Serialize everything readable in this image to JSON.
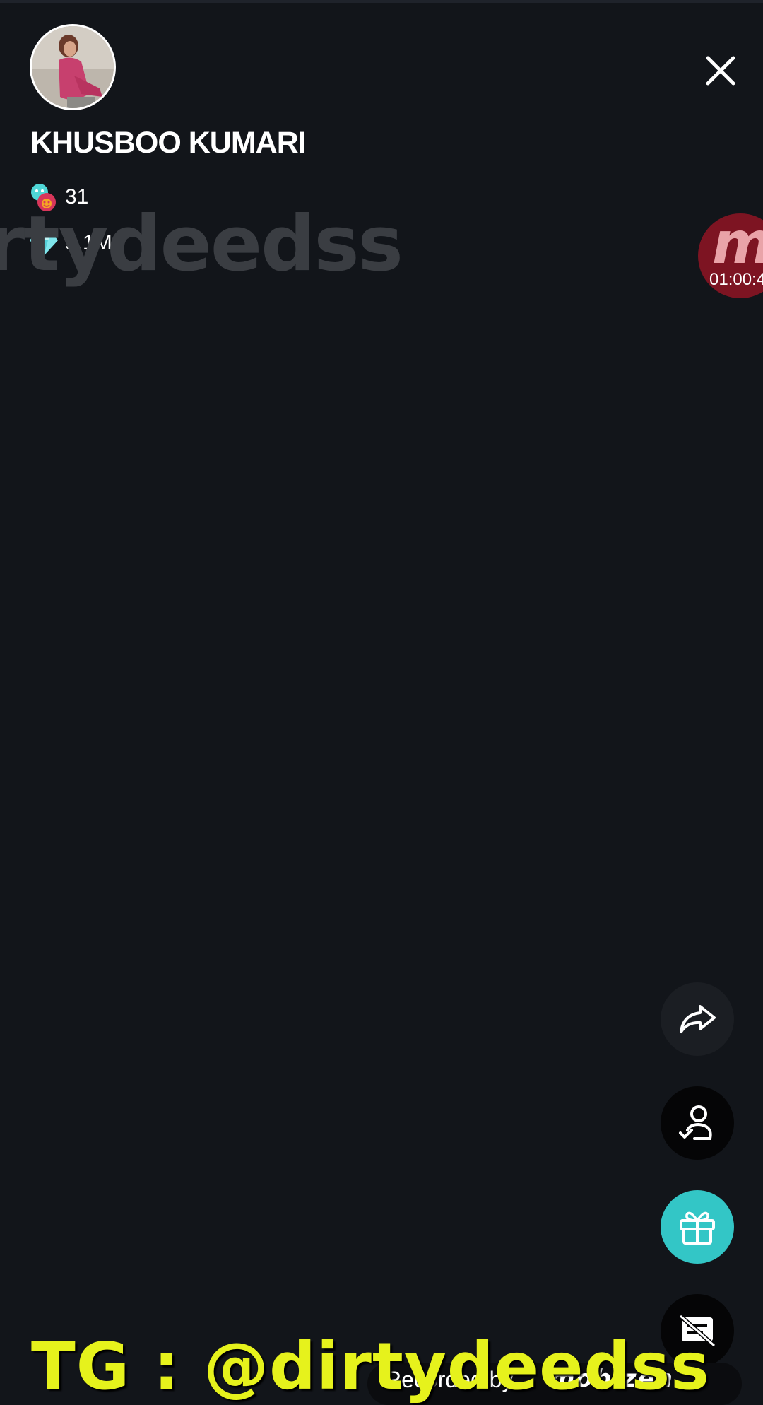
{
  "profile": {
    "name": "KHUSBOO KUMARI",
    "viewers_count": "31",
    "diamonds_count": "5.1M"
  },
  "overlays": {
    "background_watermark": "rtydeedss",
    "recording_timer": "01:00:4",
    "telegram_watermark": "TG : @dirtydeedss",
    "recorded_by_text": "Recorded by",
    "recorded_brand": "mobizen"
  },
  "side_actions": [
    {
      "name": "share",
      "icon": "share-arrow-icon"
    },
    {
      "name": "follow",
      "icon": "user-check-icon"
    },
    {
      "name": "gift",
      "icon": "gift-icon"
    },
    {
      "name": "chat",
      "icon": "message-off-icon"
    }
  ],
  "colors": {
    "background": "#12151a",
    "gift_button": "#33c6c6",
    "tg_watermark": "#e6f21c",
    "record_bubble": "#7d1422"
  }
}
